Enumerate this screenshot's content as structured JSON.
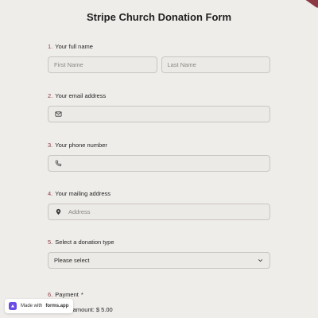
{
  "form": {
    "title": "Stripe Church Donation Form"
  },
  "questions": {
    "q1": {
      "number": "1.",
      "label": "Your full name",
      "first_placeholder": "First Name",
      "last_placeholder": "Last Name"
    },
    "q2": {
      "number": "2.",
      "label": "Your email address"
    },
    "q3": {
      "number": "3.",
      "label": "Your phone number"
    },
    "q4": {
      "number": "4.",
      "label": "Your mailing address",
      "address_placeholder": "Address"
    },
    "q5": {
      "number": "5.",
      "label": "Select a donation type",
      "select_value": "Please select"
    },
    "q6": {
      "number": "6.",
      "label": "Payment",
      "required_mark": "*",
      "amount_text": "Payment amount: $ 5.00"
    }
  },
  "badge": {
    "prefix": "Made with",
    "brand": "forms.app"
  },
  "colors": {
    "accent": "#8b3a44",
    "background": "#efedea",
    "field_border": "#c9c6c1"
  },
  "icons": [
    "envelope-icon",
    "phone-icon",
    "location-pin-icon",
    "chevron-down-icon",
    "forms-app-logo-icon"
  ]
}
